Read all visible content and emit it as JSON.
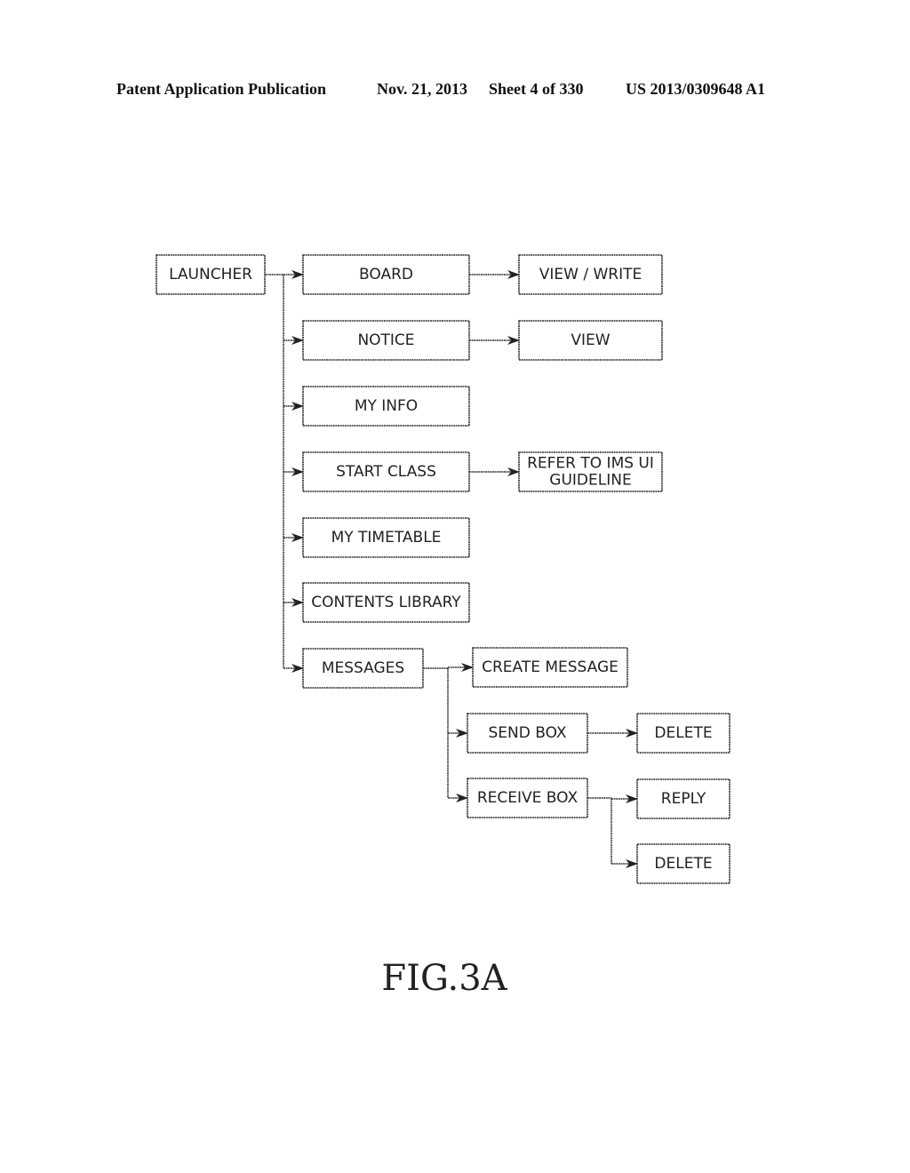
{
  "header": {
    "publication": "Patent Application Publication",
    "date": "Nov. 21, 2013",
    "sheet": "Sheet 4 of 330",
    "number": "US 2013/0309648 A1"
  },
  "figure_label": "FIG.3A",
  "nodes": [
    {
      "id": "launcher",
      "lines": [
        "LAUNCHER"
      ]
    },
    {
      "id": "board",
      "lines": [
        "BOARD"
      ]
    },
    {
      "id": "view-write",
      "lines": [
        "VIEW / WRITE"
      ]
    },
    {
      "id": "notice",
      "lines": [
        "NOTICE"
      ]
    },
    {
      "id": "view",
      "lines": [
        "VIEW"
      ]
    },
    {
      "id": "my-info",
      "lines": [
        "MY INFO"
      ]
    },
    {
      "id": "start-class",
      "lines": [
        "START CLASS"
      ]
    },
    {
      "id": "refer-ims",
      "lines": [
        "REFER TO IMS UI",
        "GUIDELINE"
      ]
    },
    {
      "id": "my-timetable",
      "lines": [
        "MY TIMETABLE"
      ]
    },
    {
      "id": "contents-library",
      "lines": [
        "CONTENTS LIBRARY"
      ]
    },
    {
      "id": "messages",
      "lines": [
        "MESSAGES"
      ]
    },
    {
      "id": "create-message",
      "lines": [
        "CREATE MESSAGE"
      ]
    },
    {
      "id": "send-box",
      "lines": [
        "SEND BOX"
      ]
    },
    {
      "id": "send-delete",
      "lines": [
        "DELETE"
      ]
    },
    {
      "id": "receive-box",
      "lines": [
        "RECEIVE BOX"
      ]
    },
    {
      "id": "reply",
      "lines": [
        "REPLY"
      ]
    },
    {
      "id": "receive-delete",
      "lines": [
        "DELETE"
      ]
    }
  ],
  "edges": [
    {
      "from": "launcher",
      "to": "board"
    },
    {
      "from": "launcher",
      "to": "notice"
    },
    {
      "from": "launcher",
      "to": "my-info"
    },
    {
      "from": "launcher",
      "to": "start-class"
    },
    {
      "from": "launcher",
      "to": "my-timetable"
    },
    {
      "from": "launcher",
      "to": "contents-library"
    },
    {
      "from": "launcher",
      "to": "messages"
    },
    {
      "from": "board",
      "to": "view-write"
    },
    {
      "from": "notice",
      "to": "view"
    },
    {
      "from": "start-class",
      "to": "refer-ims"
    },
    {
      "from": "messages",
      "to": "create-message"
    },
    {
      "from": "messages",
      "to": "send-box"
    },
    {
      "from": "messages",
      "to": "receive-box"
    },
    {
      "from": "send-box",
      "to": "send-delete"
    },
    {
      "from": "receive-box",
      "to": "reply"
    },
    {
      "from": "receive-box",
      "to": "receive-delete"
    }
  ]
}
